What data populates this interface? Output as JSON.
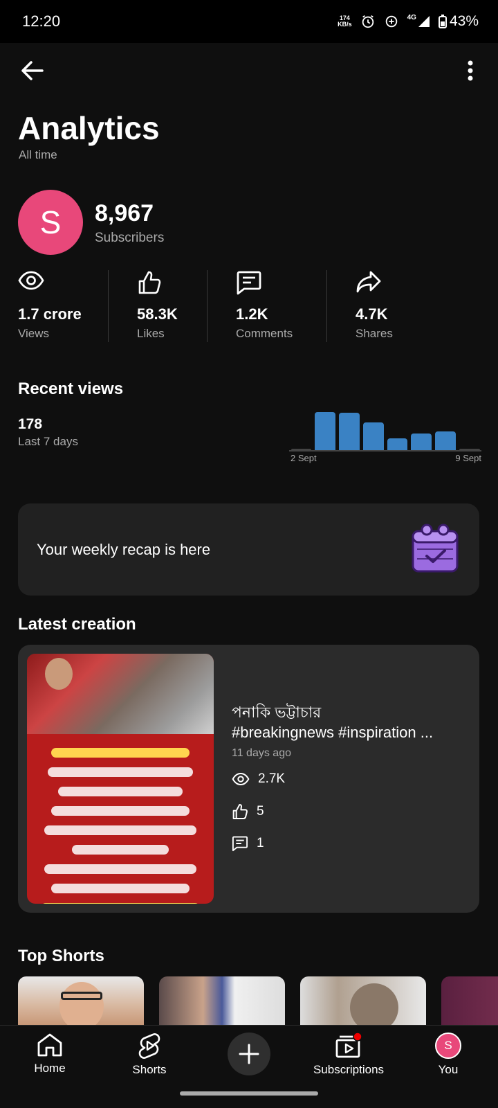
{
  "status_bar": {
    "time": "12:20",
    "net_speed_value": "174",
    "net_speed_unit": "KB/s",
    "network": "4G",
    "battery": "43%"
  },
  "header": {
    "back_icon": "arrow-left-icon",
    "more_icon": "more-vert-icon"
  },
  "page": {
    "title": "Analytics",
    "subtitle": "All time"
  },
  "channel": {
    "avatar_letter": "S",
    "avatar_color": "#e8487a",
    "subscriber_count": "8,967",
    "subscriber_label": "Subscribers"
  },
  "stats": [
    {
      "icon": "eye-icon",
      "value": "1.7 crore",
      "label": "Views"
    },
    {
      "icon": "thumb-up-icon",
      "value": "58.3K",
      "label": "Likes"
    },
    {
      "icon": "comment-icon",
      "value": "1.2K",
      "label": "Comments"
    },
    {
      "icon": "share-icon",
      "value": "4.7K",
      "label": "Shares"
    }
  ],
  "recent_views": {
    "title": "Recent views",
    "count": "178",
    "period": "Last 7 days"
  },
  "chart_data": {
    "type": "bar",
    "categories": [
      "2 Sept",
      "3 Sept",
      "4 Sept",
      "5 Sept",
      "6 Sept",
      "7 Sept",
      "8 Sept",
      "9 Sept"
    ],
    "values": [
      0,
      43,
      42,
      31,
      13,
      19,
      21,
      0
    ],
    "tick_labels": [
      "2 Sept",
      "9 Sept"
    ],
    "bar_color": "#3a82c4",
    "xlabel": "",
    "ylabel": "",
    "ylim": [
      0,
      45
    ]
  },
  "recap": {
    "text": "Your weekly recap is here",
    "icon": "calendar-check-icon"
  },
  "latest": {
    "section_title": "Latest creation",
    "title_line1": "পনাকি ভট্টাচার",
    "title_line2": "#breakingnews #inspiration ...",
    "age": "11 days ago",
    "views": "2.7K",
    "likes": "5",
    "comments": "1"
  },
  "top_shorts": {
    "title": "Top Shorts"
  },
  "nav": {
    "home": "Home",
    "shorts": "Shorts",
    "create_icon": "plus-icon",
    "subscriptions": "Subscriptions",
    "you": "You",
    "you_avatar_letter": "S"
  }
}
